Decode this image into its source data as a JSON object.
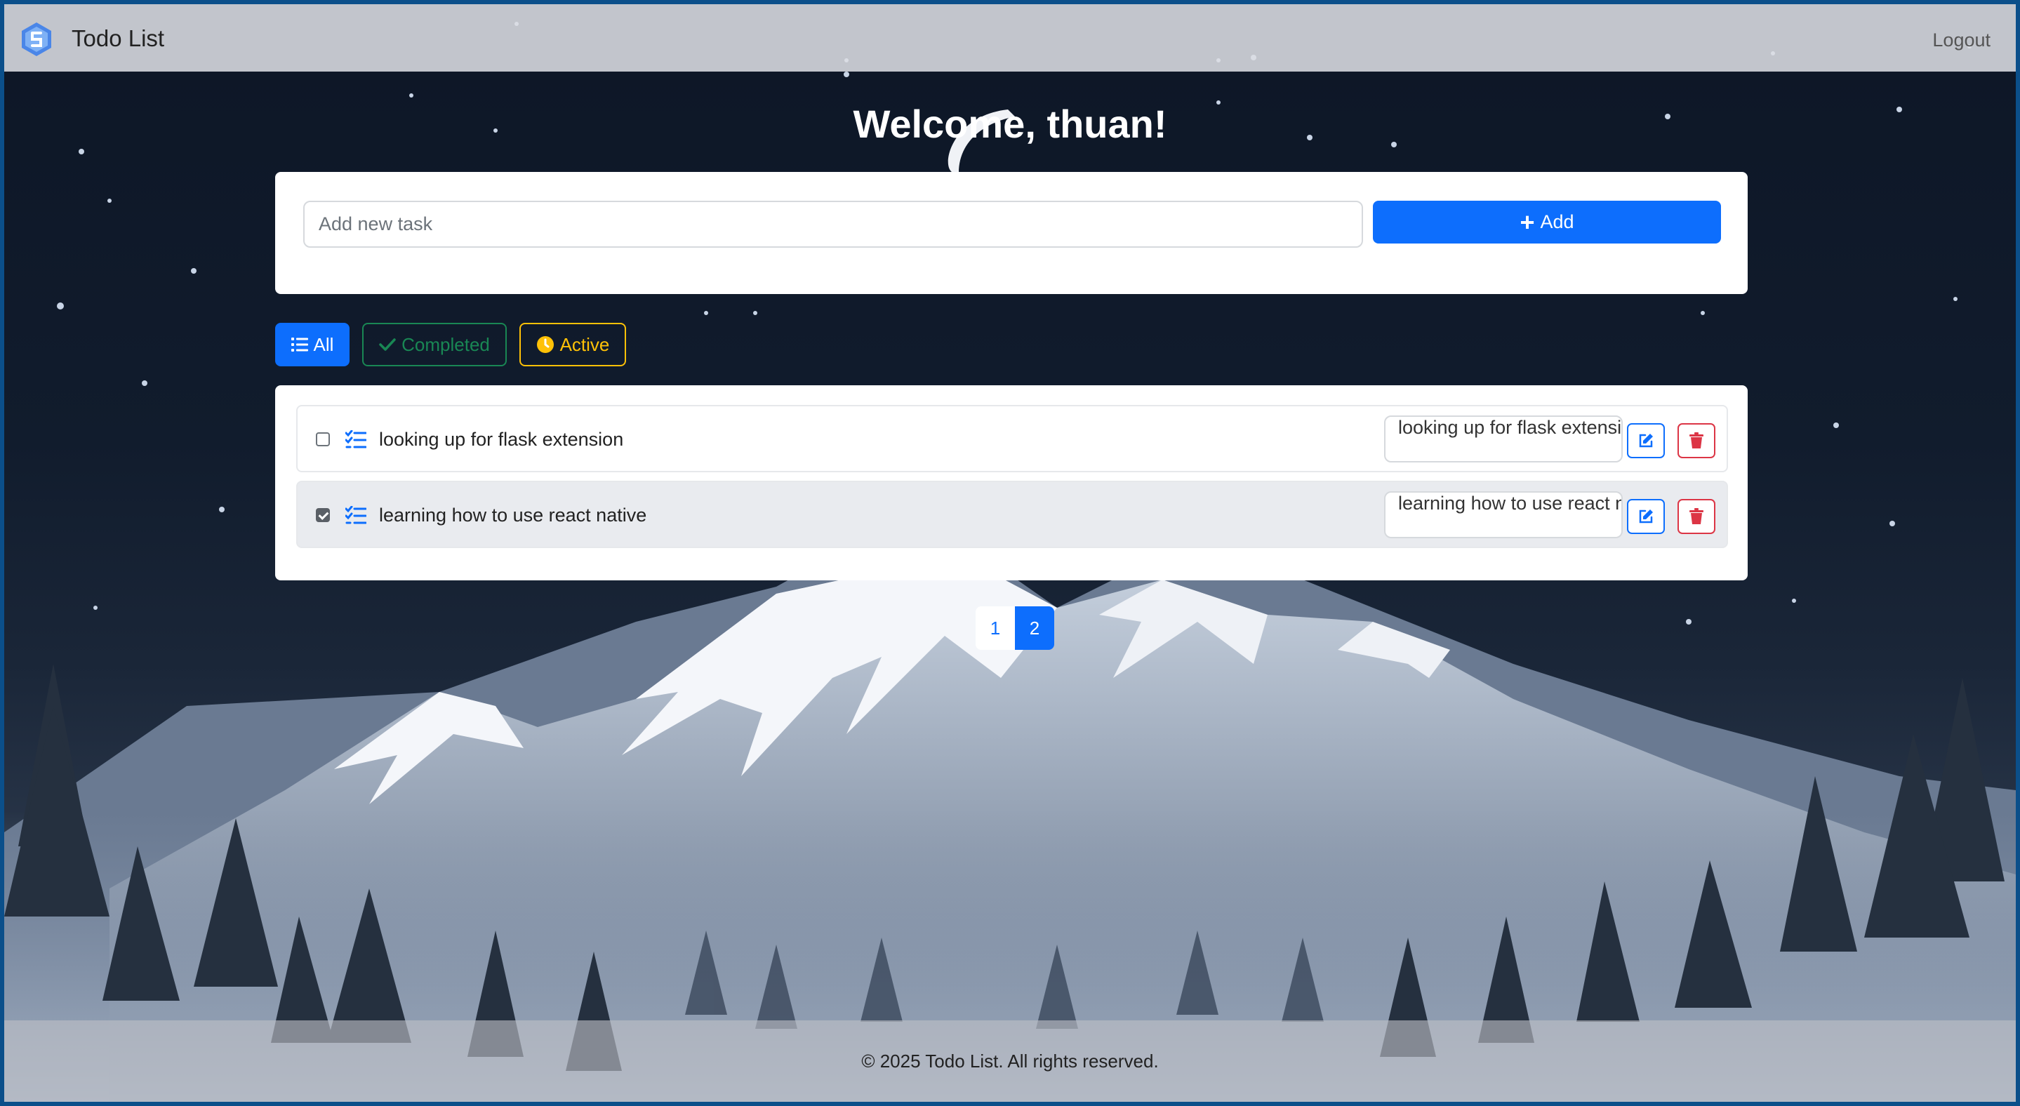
{
  "app": {
    "title": "Todo List",
    "logout_label": "Logout"
  },
  "welcome": "Welcome, thuan!",
  "add_form": {
    "placeholder": "Add new task",
    "add_label": "Add"
  },
  "filters": [
    {
      "label": "All",
      "icon": "list-icon",
      "color": "#0d6efd",
      "selected": true
    },
    {
      "label": "Completed",
      "icon": "check-icon",
      "color": "#198754",
      "selected": false
    },
    {
      "label": "Active",
      "icon": "clock-icon",
      "color": "#ffc107",
      "selected": false
    }
  ],
  "tasks": [
    {
      "text": "looking up for flask extension",
      "edit_value": "looking up for flask extension",
      "completed": false
    },
    {
      "text": "learning how to use react native",
      "edit_value": "learning how to use react native",
      "completed": true
    }
  ],
  "pagination": {
    "pages": [
      "1",
      "2"
    ],
    "current": "2"
  },
  "footer": "© 2025 Todo List. All rights reserved.",
  "colors": {
    "primary": "#0d6efd",
    "success": "#198754",
    "warning": "#ffc107",
    "danger": "#dc3545"
  }
}
